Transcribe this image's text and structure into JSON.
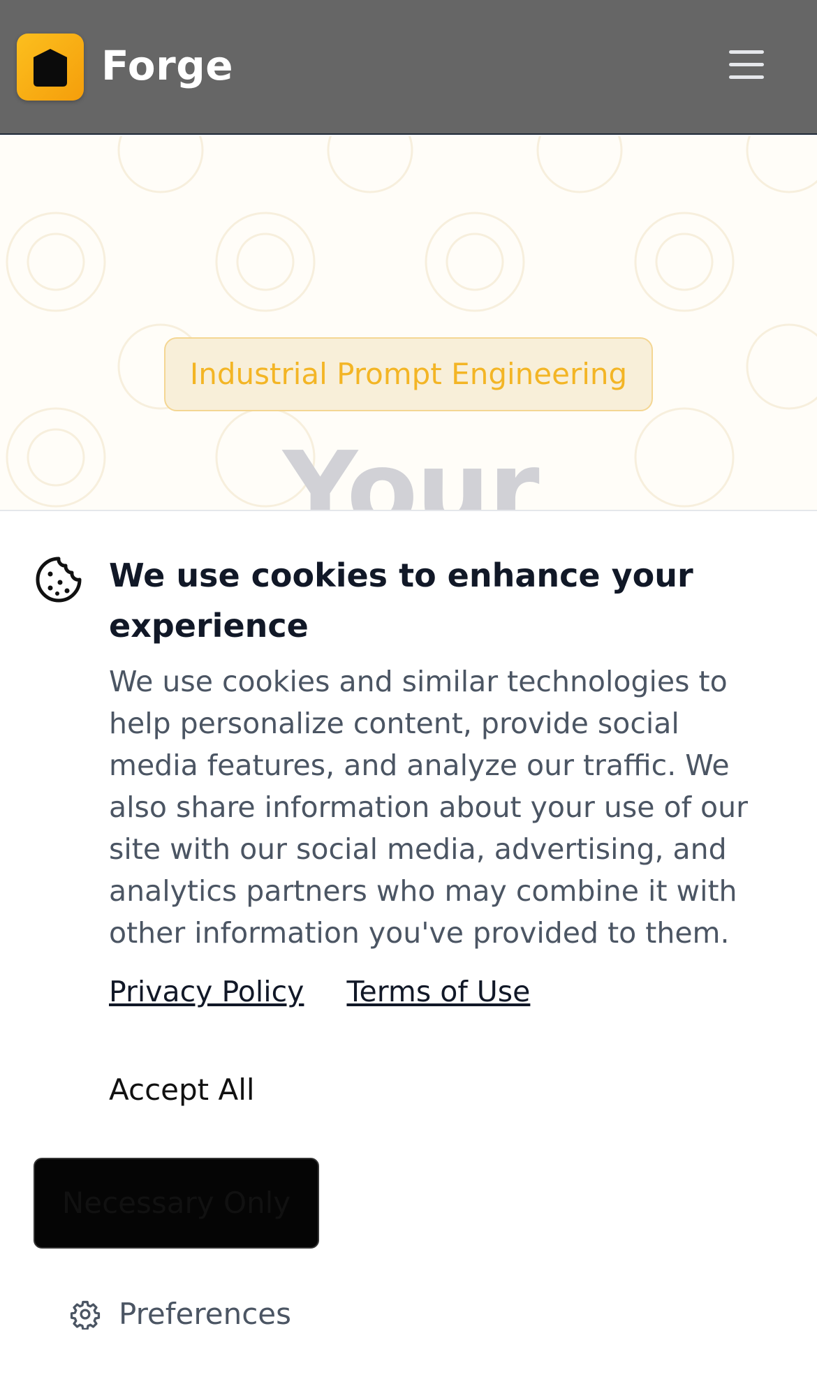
{
  "header": {
    "brand": "Forge",
    "logo_icon": "forge-logo-icon",
    "menu_icon": "hamburger-menu-icon"
  },
  "hero": {
    "tag": "Industrial Prompt Engineering",
    "title_partial": "Your"
  },
  "cookie_banner": {
    "icon": "cookie-icon",
    "title": "We use cookies to enhance your experience",
    "body": "We use cookies and similar technologies to help personalize content, provide social media features, and analyze our traffic. We also share information about your use of our site with our social media, advertising, and analytics partners who may combine it with other information you've provided to them.",
    "links": {
      "privacy": "Privacy Policy",
      "terms": "Terms of Use"
    },
    "accept_label": "Accept All",
    "necessary_label": "Necessary Only",
    "preferences_label": "Preferences",
    "preferences_icon": "gear-icon"
  },
  "colors": {
    "header_bg": "#666666",
    "accent": "#f59e0b",
    "tag_text": "#f3b525"
  }
}
